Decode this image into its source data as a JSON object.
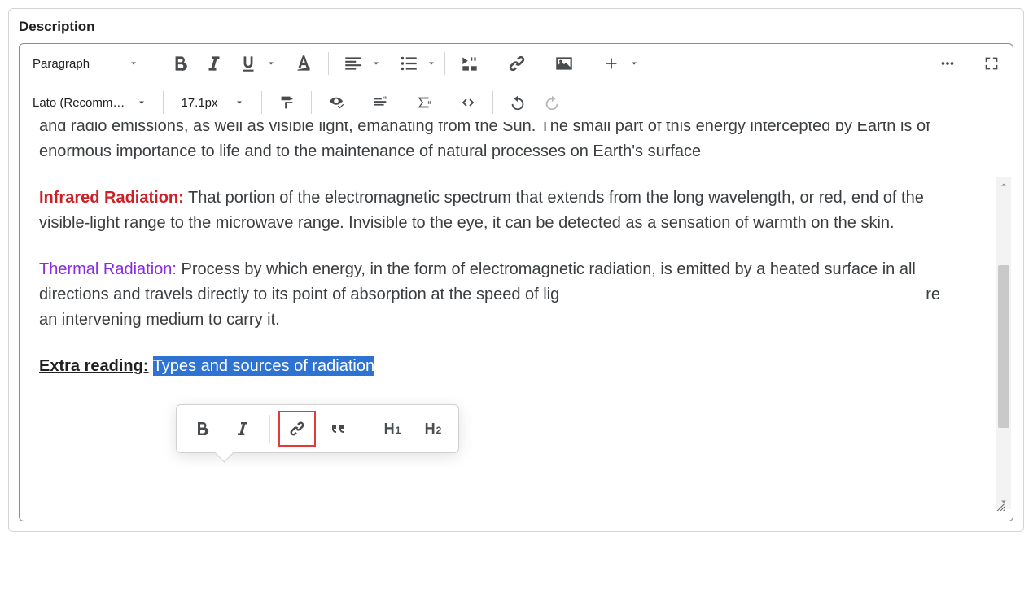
{
  "label": "Description",
  "toolbar": {
    "block_format": "Paragraph",
    "font_family": "Lato (Recomm…",
    "font_size": "17.1px"
  },
  "content": {
    "p1": "and radio emissions, as well as visible light, emanating from the Sun. The small part of this energy intercepted by Earth is of enormous importance to life and to the maintenance of natural processes on Earth's surface",
    "p2_label": "Infrared Radiation:",
    "p2_body": " That portion of the electromagnetic spectrum that extends from the long wavelength, or red, end of the visible-light range to the microwave range. Invisible to the eye, it can be detected as a sensation of warmth on the skin.",
    "p3_label": "Thermal Radiation:",
    "p3_body_before": " Process by which energy, in the form of electromagnetic radiation, is emitted by a heated surface in all directions and travels directly to its point of absorption at the speed of lig",
    "p3_body_after": "re an intervening medium to carry it.",
    "extra_label": "Extra reading:",
    "extra_link": "Types and sources of radiation"
  },
  "float": {
    "h1": "H",
    "h1_sub": "1",
    "h2": "H",
    "h2_sub": "2"
  }
}
